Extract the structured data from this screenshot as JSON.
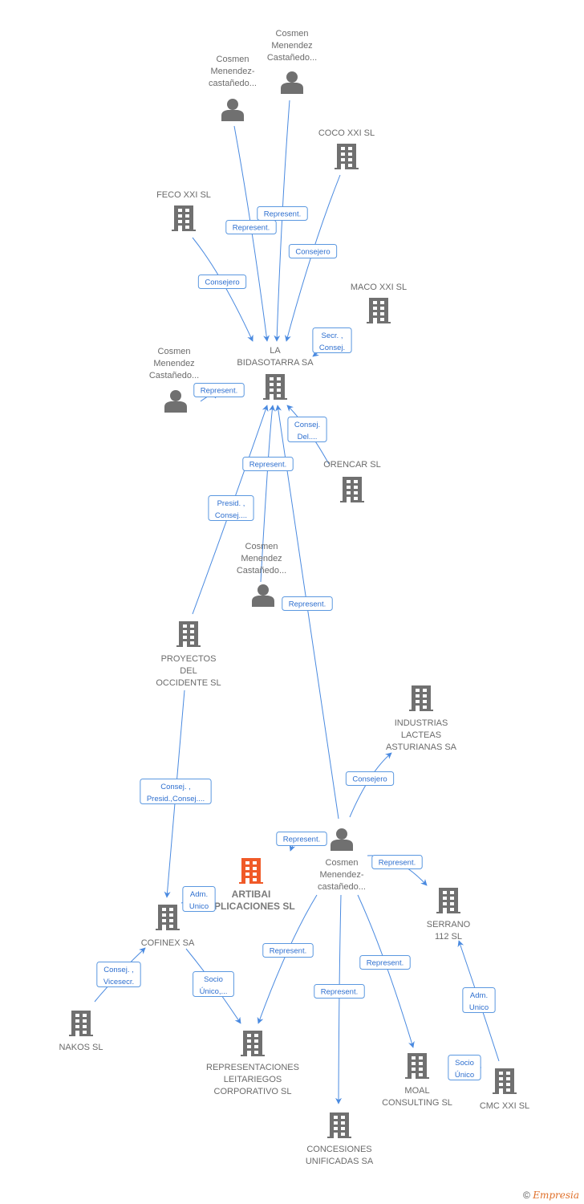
{
  "colors": {
    "node": "#707070",
    "focus": "#f05a28",
    "edge": "#4a8ae0",
    "label_text": "#2e6fcf"
  },
  "nodes": [
    {
      "id": "p1",
      "type": "person",
      "label": [
        "Cosmen",
        "Menendez-",
        "castañedo..."
      ]
    },
    {
      "id": "p2",
      "type": "person",
      "label": [
        "Cosmen",
        "Menendez",
        "Castañedo..."
      ]
    },
    {
      "id": "coco",
      "type": "company",
      "label": [
        "COCO XXI SL"
      ]
    },
    {
      "id": "feco",
      "type": "company",
      "label": [
        "FECO XXI SL"
      ]
    },
    {
      "id": "maco",
      "type": "company",
      "label": [
        "MACO XXI SL"
      ]
    },
    {
      "id": "bid",
      "type": "company",
      "label": [
        "LA",
        "BIDASOTARRA SA"
      ]
    },
    {
      "id": "p3",
      "type": "person",
      "label": [
        "Cosmen",
        "Menendez",
        "Castañedo..."
      ]
    },
    {
      "id": "orencar",
      "type": "company",
      "label": [
        "ORENCAR SL"
      ]
    },
    {
      "id": "p4",
      "type": "person",
      "label": [
        "Cosmen",
        "Menendez",
        "Castañedo..."
      ]
    },
    {
      "id": "proyectos",
      "type": "company",
      "label": [
        "PROYECTOS",
        "DEL",
        "OCCIDENTE SL"
      ]
    },
    {
      "id": "industrias",
      "type": "company",
      "label": [
        "INDUSTRIAS",
        "LACTEAS",
        "ASTURIANAS SA"
      ]
    },
    {
      "id": "p5",
      "type": "person",
      "label": [
        "Cosmen",
        "Menendez-",
        "castañedo..."
      ]
    },
    {
      "id": "artibai",
      "type": "company",
      "focus": true,
      "label": [
        "ARTIBAI",
        "APLICACIONES SL"
      ]
    },
    {
      "id": "serrano",
      "type": "company",
      "label": [
        "SERRANO",
        "112 SL"
      ]
    },
    {
      "id": "cofinex",
      "type": "company",
      "label": [
        "COFINEX SA"
      ]
    },
    {
      "id": "nakos",
      "type": "company",
      "label": [
        "NAKOS SL"
      ]
    },
    {
      "id": "repr",
      "type": "company",
      "label": [
        "REPRESENTACIONES",
        "LEITARIEGOS",
        "CORPORATIVO SL"
      ]
    },
    {
      "id": "moal",
      "type": "company",
      "label": [
        "MOAL",
        "CONSULTING SL"
      ]
    },
    {
      "id": "cmc",
      "type": "company",
      "label": [
        "CMC XXI  SL"
      ]
    },
    {
      "id": "concesiones",
      "type": "company",
      "label": [
        "CONCESIONES",
        "UNIFICADAS SA"
      ]
    }
  ],
  "edges": [
    {
      "from": "p1",
      "to": "bid",
      "label": [
        "Represent."
      ]
    },
    {
      "from": "p2",
      "to": "bid",
      "label": [
        "Represent."
      ]
    },
    {
      "from": "coco",
      "to": "bid",
      "label": [
        "Consejero"
      ]
    },
    {
      "from": "feco",
      "to": "bid",
      "label": [
        "Consejero"
      ]
    },
    {
      "from": "maco",
      "to": "bid",
      "label": [
        "Secr. ,",
        "Consej."
      ]
    },
    {
      "from": "p3",
      "to": "bid",
      "label": [
        "Represent."
      ]
    },
    {
      "from": "orencar",
      "to": "bid",
      "label": [
        "Consej.",
        "Del...."
      ]
    },
    {
      "from": "p4",
      "to": "bid",
      "label": [
        "Represent."
      ]
    },
    {
      "from": "proyectos",
      "to": "bid",
      "label": [
        "Presid. ,",
        "Consej...."
      ]
    },
    {
      "from": "p5",
      "to": "bid",
      "label": [
        "Represent."
      ]
    },
    {
      "from": "proyectos",
      "to": "cofinex",
      "label": [
        "Consej. ,",
        "Presid.,Consej...."
      ]
    },
    {
      "from": "p5",
      "to": "industrias",
      "label": [
        "Consejero"
      ]
    },
    {
      "from": "p5",
      "to": "artibai",
      "label": [
        "Represent."
      ]
    },
    {
      "from": "p5",
      "to": "serrano",
      "label": [
        "Represent."
      ]
    },
    {
      "from": "cofinex",
      "to": "artibai",
      "label": [
        "Adm.",
        "Unico"
      ]
    },
    {
      "from": "nakos",
      "to": "cofinex",
      "label": [
        "Consej. ,",
        "Vicesecr."
      ]
    },
    {
      "from": "cofinex",
      "to": "repr",
      "label": [
        "Socio",
        "Único,..."
      ]
    },
    {
      "from": "p5",
      "to": "repr",
      "label": [
        "Represent."
      ]
    },
    {
      "from": "p5",
      "to": "concesiones",
      "label": [
        "Represent."
      ]
    },
    {
      "from": "p5",
      "to": "moal",
      "label": [
        "Represent."
      ]
    },
    {
      "from": "cmc",
      "to": "serrano",
      "label": [
        "Adm.",
        "Unico"
      ]
    },
    {
      "from": "cmc",
      "to": "moal",
      "label": [
        "Socio",
        "Único"
      ]
    }
  ],
  "footer": {
    "copyright": "©",
    "brand": "Empresia"
  }
}
